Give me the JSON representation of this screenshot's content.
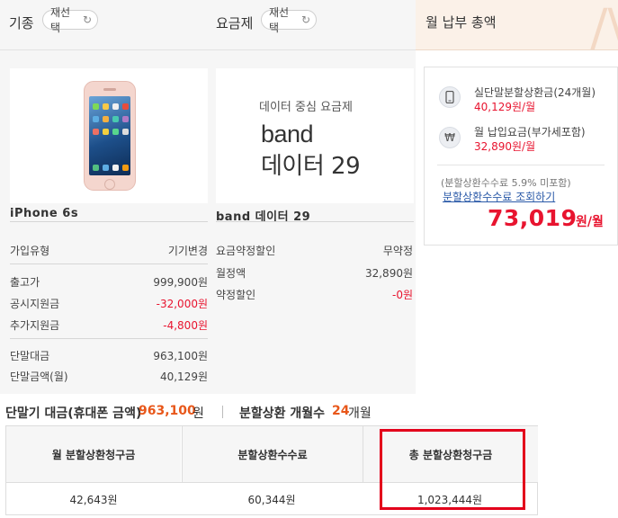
{
  "header": {
    "device_title": "기종",
    "plan_title": "요금제",
    "reselect_label": "재선택",
    "summary_title": "월 납부 총액"
  },
  "device": {
    "name": "iPhone 6s",
    "rows": [
      {
        "label": "가입유형",
        "value": "기기변경"
      },
      {
        "label": "출고가",
        "value": "999,900원"
      },
      {
        "label": "공시지원금",
        "value": "-32,000원"
      },
      {
        "label": "추가지원금",
        "value": "-4,800원"
      },
      {
        "label": "단말대금",
        "value": "963,100원"
      },
      {
        "label": "단말금액(월)",
        "value": "40,129원"
      }
    ]
  },
  "plan": {
    "card_subtitle": "데이터 중심 요금제",
    "card_title_line1": "band",
    "card_title_line2": "데이터 29",
    "name": "band 데이터 29",
    "rows": [
      {
        "label": "요금약정할인",
        "value": "무약정"
      },
      {
        "label": "월정액",
        "value": "32,890원"
      },
      {
        "label": "약정할인",
        "value": "-0원"
      }
    ]
  },
  "summary": {
    "installment_label": "실단말분할상환금(24개월)",
    "installment_value": "40,129원/월",
    "monthly_fee_label": "월 납입요금(부가세포함)",
    "monthly_fee_value": "32,890원/월",
    "fee_note": "(분할상환수수료 5.9% 미포함)",
    "fee_link": "분할상환수수료 조회하기",
    "total_value": "73,019",
    "total_unit": "원/월"
  },
  "bottom": {
    "device_price_label": "단말기 대금(휴대폰 금액)",
    "device_price_value": "963,100",
    "device_price_unit": "원",
    "months_label": "분할상환 개월수",
    "months_value": "24",
    "months_unit": "개월",
    "table": {
      "headers": [
        "월 분할상환청구금",
        "분할상환수수료",
        "총 분할상환청구금"
      ],
      "values": [
        "42,643원",
        "60,344원",
        "1,023,444원"
      ]
    }
  },
  "colors": {
    "accent_red": "#e8142f",
    "accent_orange": "#e8571a",
    "highlight_box": "#e3001b"
  }
}
